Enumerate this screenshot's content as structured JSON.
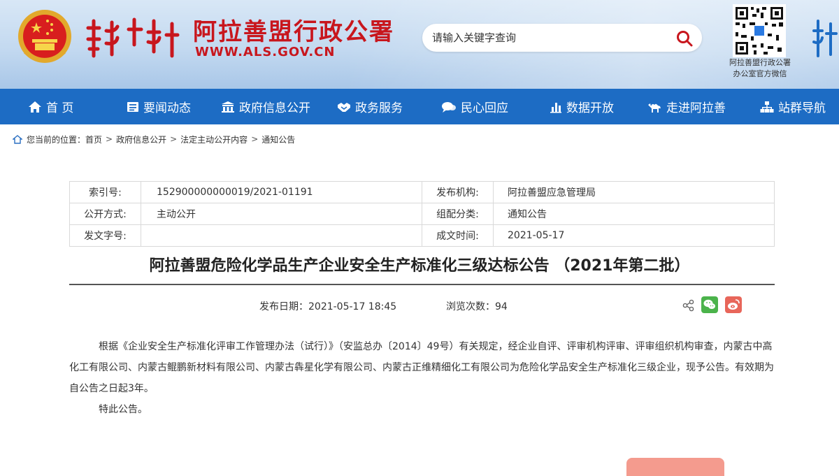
{
  "header": {
    "site_title": "阿拉善盟行政公署",
    "site_url": "WWW.ALS.GOV.CN",
    "search_placeholder": "请输入关键字查询",
    "qr_caption_line1": "阿拉善盟行政公署",
    "qr_caption_line2": "办公室官方微信",
    "title_color": "#c8161d"
  },
  "nav": {
    "accent_color": "#1d6cc4",
    "items": [
      {
        "label": "首 页",
        "icon": "home-icon"
      },
      {
        "label": "要闻动态",
        "icon": "news-icon"
      },
      {
        "label": "政府信息公开",
        "icon": "building-icon"
      },
      {
        "label": "政务服务",
        "icon": "handshake-icon"
      },
      {
        "label": "民心回应",
        "icon": "chat-icon"
      },
      {
        "label": "数据开放",
        "icon": "bar-chart-icon"
      },
      {
        "label": "走进阿拉善",
        "icon": "camel-icon"
      },
      {
        "label": "站群导航",
        "icon": "sitemap-icon"
      }
    ]
  },
  "breadcrumb": {
    "prefix": "您当前的位置：",
    "items": [
      "首页",
      "政府信息公开",
      "法定主动公开内容",
      "通知公告"
    ],
    "separator": ">"
  },
  "meta": {
    "index_label": "索引号:",
    "index_value": "152900000000019/2021-01191",
    "publisher_label": "发布机构:",
    "publisher_value": "阿拉善盟应急管理局",
    "disclosure_label": "公开方式:",
    "disclosure_value": "主动公开",
    "category_label": "组配分类:",
    "category_value": "通知公告",
    "doc_no_label": "发文字号:",
    "doc_no_value": "",
    "date_label": "成文时间:",
    "date_value": "2021-05-17"
  },
  "article": {
    "title": "阿拉善盟危险化学品生产企业安全生产标准化三级达标公告 （2021年第二批）",
    "publish_date": "发布日期：2021-05-17 18:45",
    "view_count": "浏览次数：94",
    "paragraph1": "根据《企业安全生产标准化评审工作管理办法（试行）》（安监总办〔2014〕49号）有关规定，经企业自评、评审机构评审、评审组织机构审查，内蒙古中高化工有限公司、内蒙古鲲鹏新材料有限公司、内蒙古犇星化学有限公司、内蒙古正维精细化工有限公司为危险化学品安全生产标准化三级企业，现予公告。有效期为自公告之日起3年。",
    "paragraph2": "特此公告。"
  }
}
